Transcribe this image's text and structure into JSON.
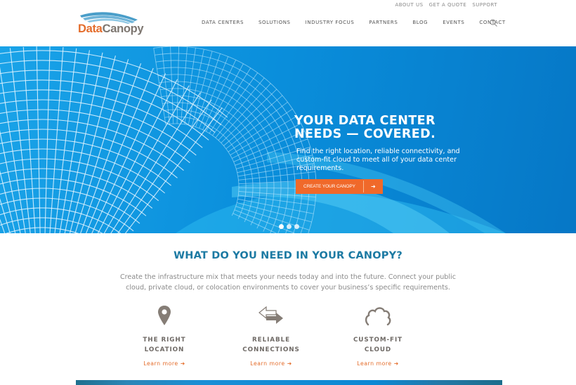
{
  "brand": {
    "name_part1": "Data",
    "name_part2": "Canopy",
    "accent_orange": "#e46d2c",
    "accent_blue": "#1c7aa3"
  },
  "utility_nav": [
    "ABOUT US",
    "GET A QUOTE",
    "SUPPORT"
  ],
  "main_nav": [
    "DATA CENTERS",
    "SOLUTIONS",
    "INDUSTRY FOCUS",
    "PARTNERS",
    "BLOG",
    "EVENTS",
    "CONTACT"
  ],
  "search_icon": "search-icon",
  "hero": {
    "title": "YOUR DATA CENTER\nNEEDS — COVERED.",
    "subtitle": "Find the right location, reliable connectivity, and custom-fit cloud to meet all of your data center requirements.",
    "cta_label": "CREATE YOUR CANOPY",
    "cta_arrow": "➜",
    "slides_count": 3,
    "active_slide": 1
  },
  "section": {
    "title": "WHAT DO YOU NEED IN YOUR CANOPY?",
    "description": "Create the infrastructure mix that meets your needs today and into the future. Connect your public cloud, private cloud, or colocation environments to cover your business’s specific requirements."
  },
  "features": [
    {
      "icon": "map-pin-icon",
      "title": "THE RIGHT\nLOCATION",
      "link": "Learn more ➜"
    },
    {
      "icon": "exchange-arrows-icon",
      "title": "RELIABLE\nCONNECTIONS",
      "link": "Learn more ➜"
    },
    {
      "icon": "cloud-icon",
      "title": "CUSTOM-FIT\nCLOUD",
      "link": "Learn more ➜"
    }
  ]
}
